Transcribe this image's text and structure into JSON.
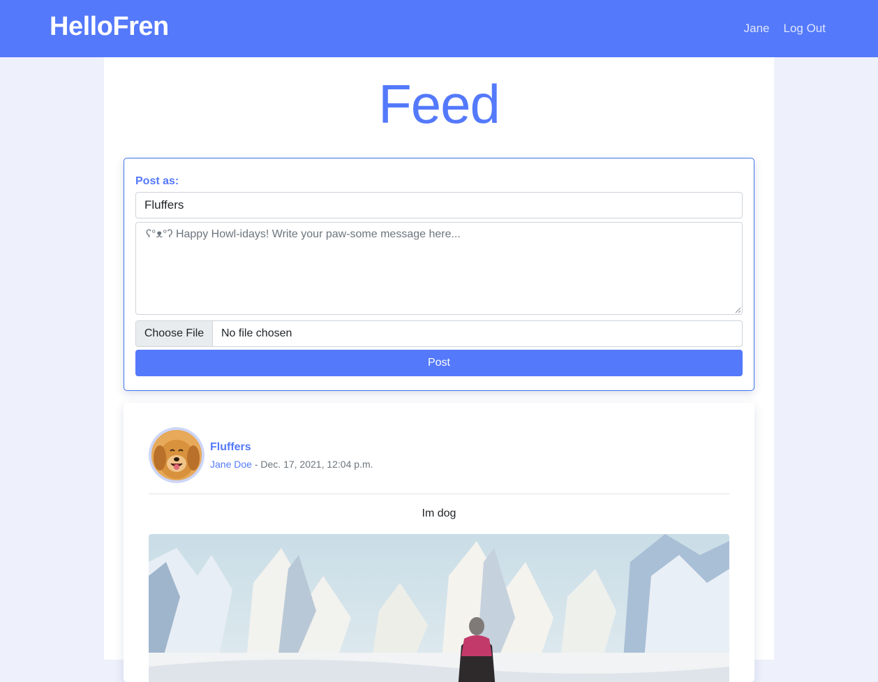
{
  "navbar": {
    "brand": "HelloFren",
    "links": [
      {
        "label": "Jane"
      },
      {
        "label": "Log Out"
      }
    ]
  },
  "page": {
    "title": "Feed"
  },
  "post_form": {
    "label": "Post as:",
    "pet_name_value": "Fluffers",
    "message_placeholder": "ʕ°ᴥ°ʔ Happy Howl-idays! Write your paw-some message here...",
    "file_button": "Choose File",
    "file_status": "No file chosen",
    "submit": "Post"
  },
  "posts": [
    {
      "pet_name": "Fluffers",
      "owner": "Jane Doe",
      "separator": " - ",
      "timestamp": "Dec. 17, 2021, 12:04 p.m.",
      "text": "Im dog"
    }
  ],
  "colors": {
    "brand": "#5479fb",
    "background": "#eef0fb",
    "muted": "#6c757d"
  }
}
